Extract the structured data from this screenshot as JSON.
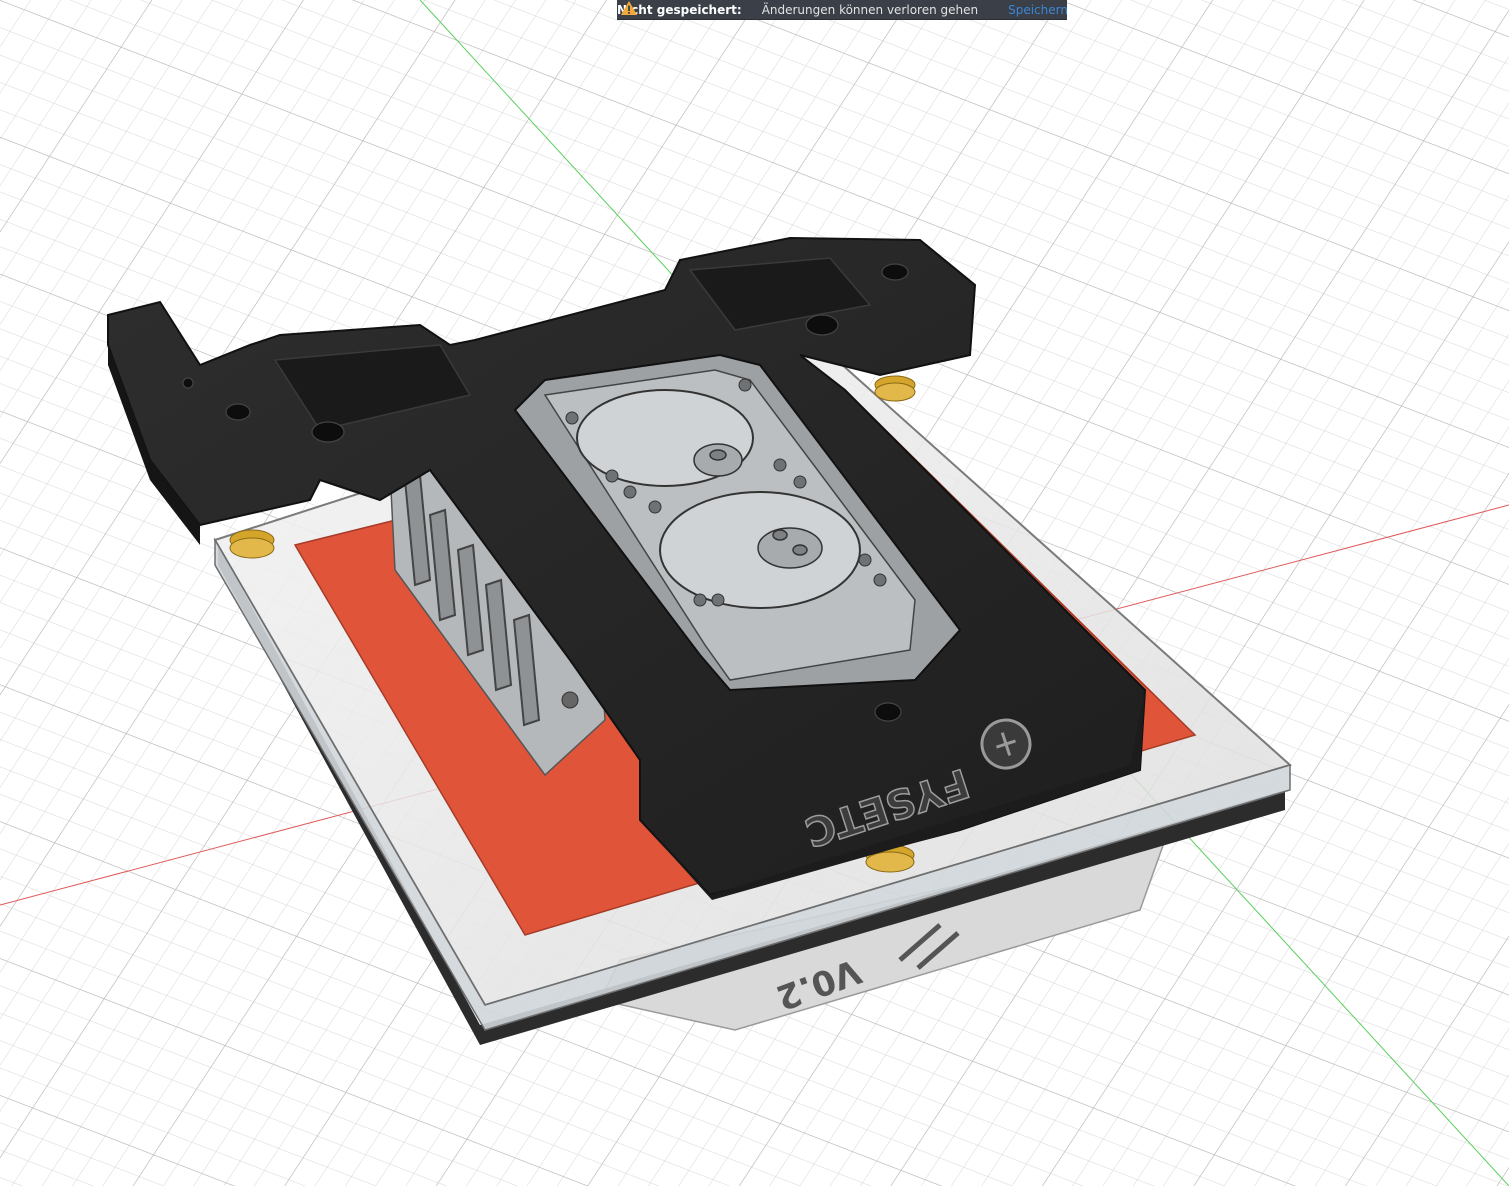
{
  "notification": {
    "title": "Nicht gespeichert:",
    "message": "Änderungen können verloren gehen",
    "action_label": "Speichern",
    "icon": "warning-icon",
    "icon_color": "#f2a93b",
    "link_color": "#3a86d6"
  },
  "model": {
    "brand_text": "FYSETC",
    "plate_text": "V0.2",
    "colors": {
      "frame": "#262626",
      "heater_pad": "#e0553a",
      "bed_plate": "#e6e6e6",
      "mechanism": "#b8b8b8",
      "springs": "#d4a52a",
      "x_axis": "#e05a5a",
      "y_axis": "#5ad05a"
    }
  }
}
